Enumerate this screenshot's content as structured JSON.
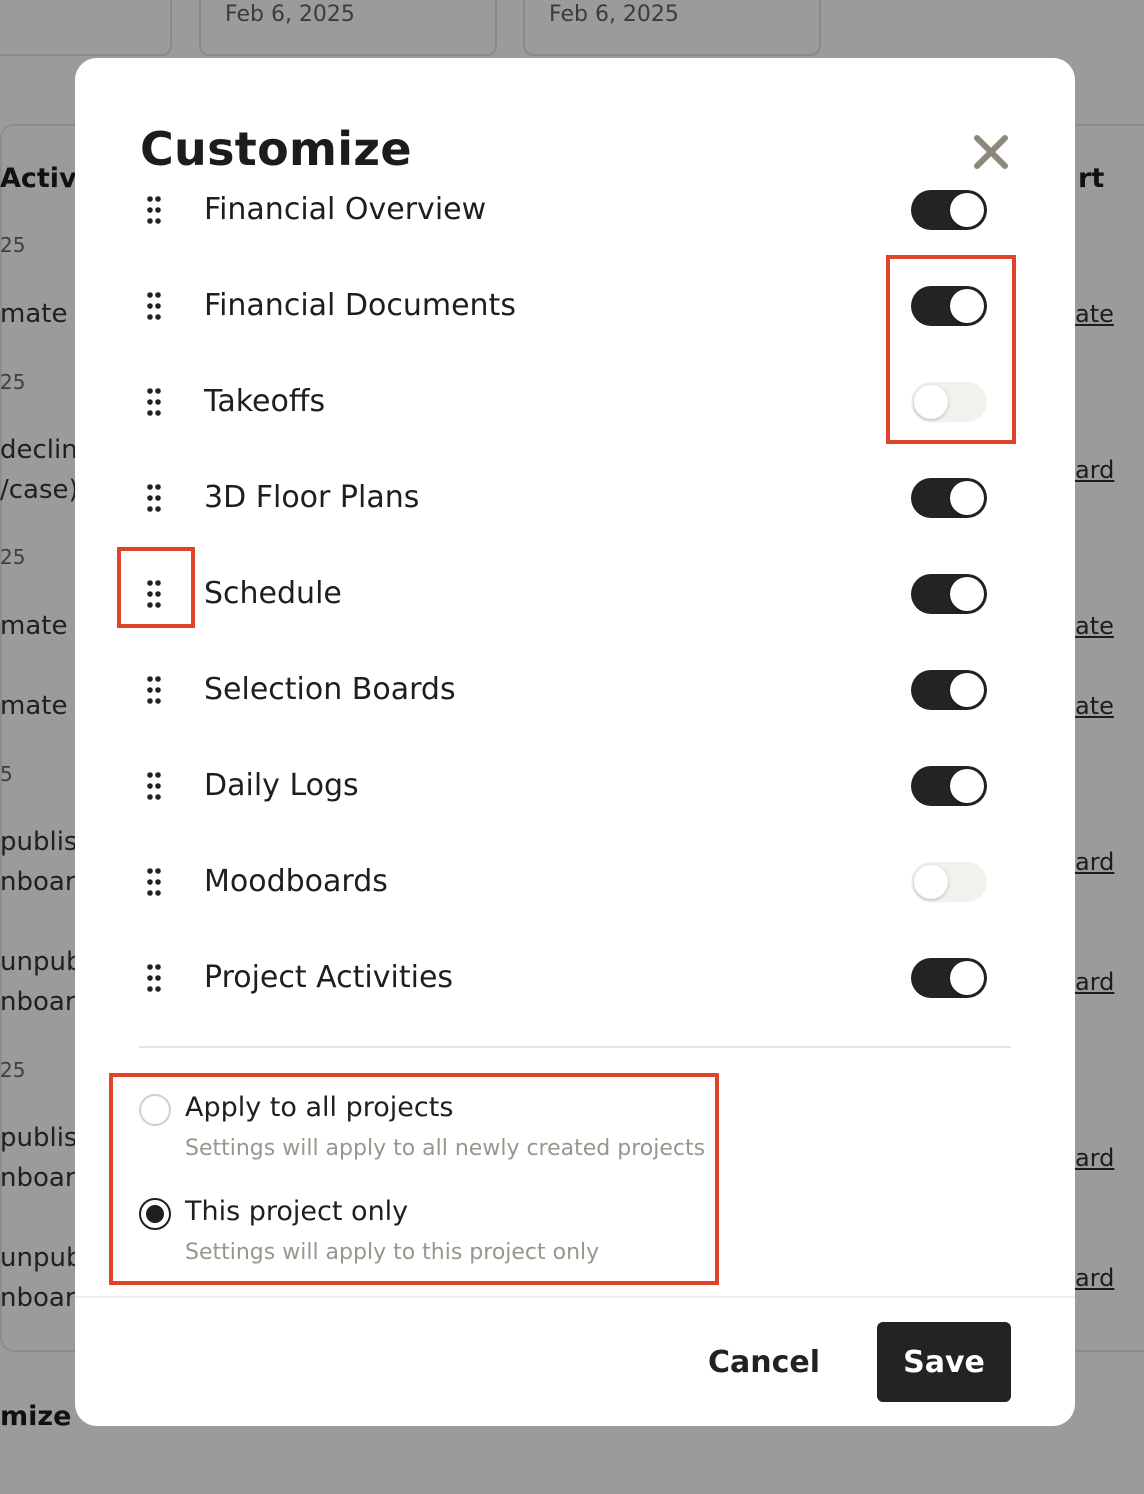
{
  "background": {
    "dates": [
      "Feb 6, 2025",
      "Feb 6, 2025"
    ],
    "heading_left": "Activit",
    "heading_right": "rt",
    "left_fragments": [
      "25",
      "mate E",
      "25",
      "declin",
      "/case)",
      "25",
      "mate E",
      "mate E",
      "5",
      "publis",
      "nboard",
      "unpub",
      "nboard",
      "25",
      "publis",
      "nboard",
      "unpub",
      "nboard"
    ],
    "right_links": [
      "ate",
      "ard",
      "ate",
      "ate",
      "ard",
      "ard",
      "ard",
      "ard"
    ],
    "bottom_fragment": "mize"
  },
  "modal": {
    "title": "Customize",
    "items": [
      {
        "label": "Financial Overview",
        "enabled": true
      },
      {
        "label": "Financial Documents",
        "enabled": true
      },
      {
        "label": "Takeoffs",
        "enabled": false
      },
      {
        "label": "3D Floor Plans",
        "enabled": true
      },
      {
        "label": "Schedule",
        "enabled": true
      },
      {
        "label": "Selection Boards",
        "enabled": true
      },
      {
        "label": "Daily Logs",
        "enabled": true
      },
      {
        "label": "Moodboards",
        "enabled": false
      },
      {
        "label": "Project Activities",
        "enabled": true
      }
    ],
    "scope": {
      "all": {
        "label": "Apply to all projects",
        "help": "Settings will apply to all newly created projects",
        "selected": false
      },
      "this": {
        "label": "This project only",
        "help": "Settings will apply to this project only",
        "selected": true
      }
    },
    "cancel_label": "Cancel",
    "save_label": "Save"
  },
  "colors": {
    "accent": "#232323",
    "annotation": "#e0452c",
    "toggle_off": "#f3f1ec"
  }
}
